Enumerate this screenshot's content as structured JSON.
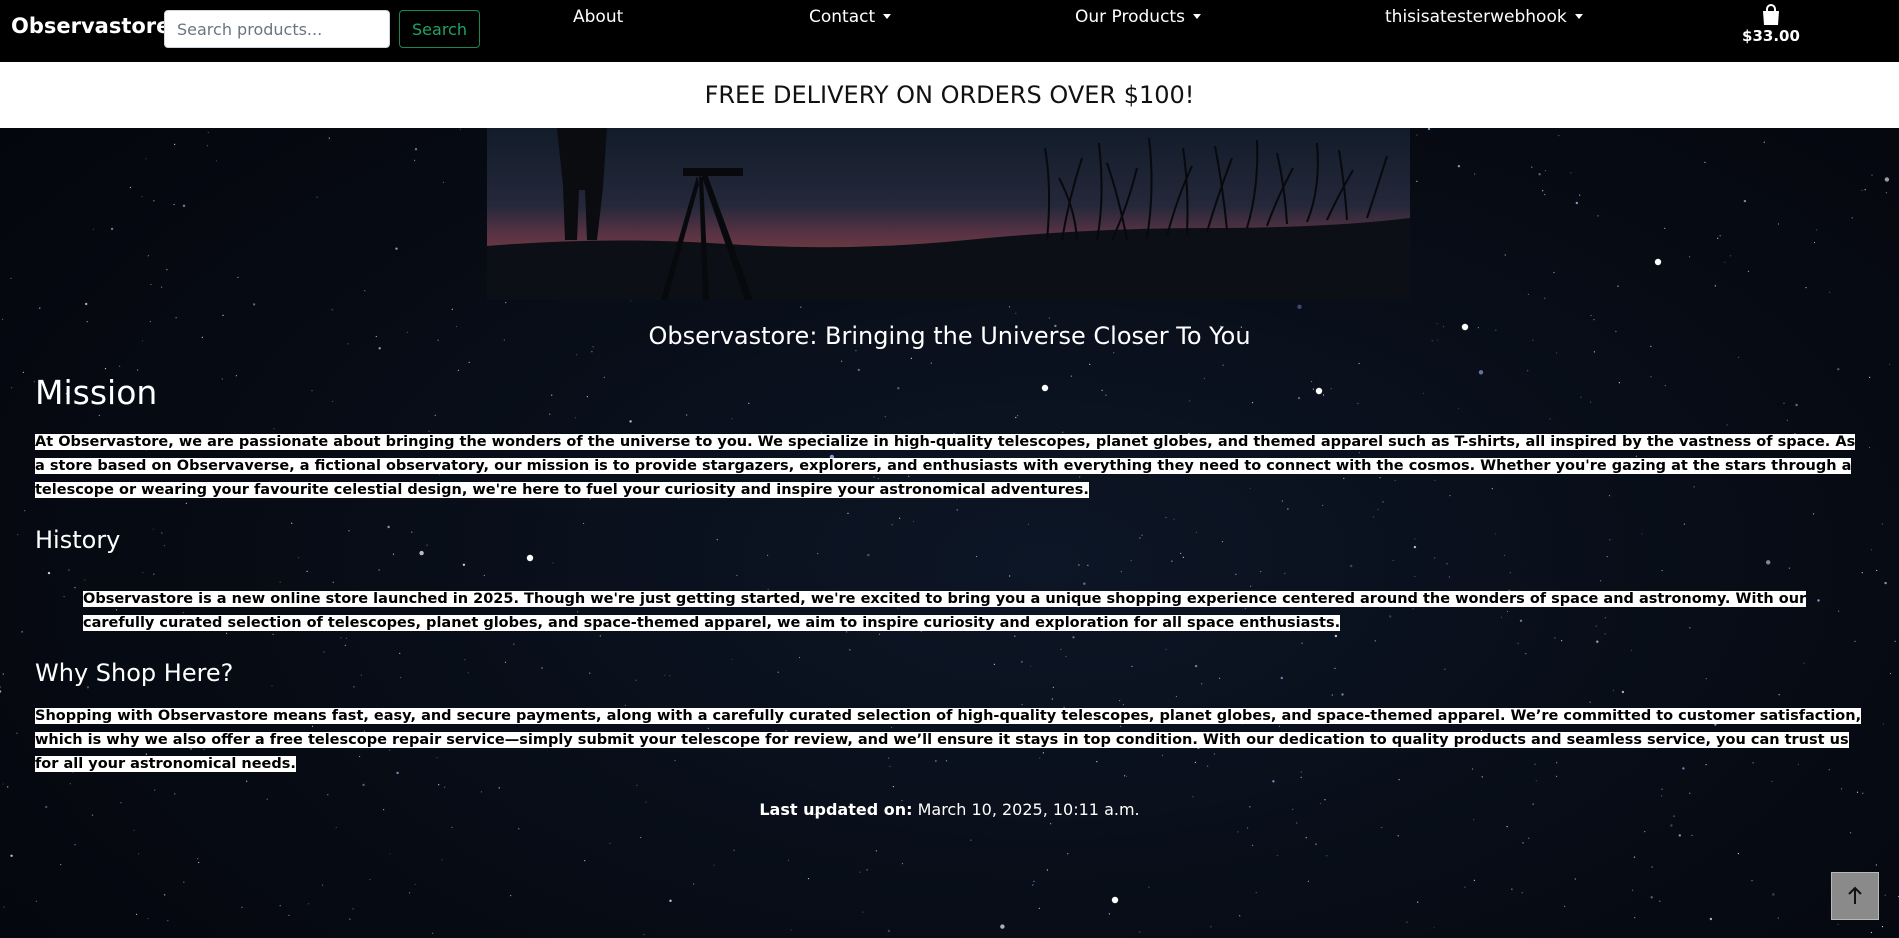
{
  "navbar": {
    "brand": "Observastore",
    "search_placeholder": "Search products...",
    "search_value": "",
    "search_button": "Search",
    "links": {
      "about": "About",
      "contact": "Contact",
      "products": "Our Products",
      "account": "thisisatesterwebhook"
    },
    "cart_total": "$33.00",
    "cart_icon": "shopping-bag-icon"
  },
  "banner": {
    "text": "FREE DELIVERY ON ORDERS OVER $100!"
  },
  "hero": {
    "image": "telescope-silhouette-at-dusk"
  },
  "main": {
    "tagline": "Observastore: Bringing the Universe Closer To You",
    "mission": {
      "heading": "Mission",
      "text": "At Observastore, we are passionate about bringing the wonders of the universe to you. We specialize in high-quality telescopes, planet globes, and themed apparel such as T-shirts, all inspired by the vastness of space. As a store based on Observaverse, a fictional observatory, our mission is to provide stargazers, explorers, and enthusiasts with everything they need to connect with the cosmos. Whether you're gazing at the stars through a telescope or wearing your favourite celestial design, we're here to fuel your curiosity and inspire your astronomical adventures."
    },
    "history": {
      "heading": "History",
      "text": "Observastore is a new online store launched in 2025. Though we're just getting started, we're excited to bring you a unique shopping experience centered around the wonders of space and astronomy. With our carefully curated selection of telescopes, planet globes, and space-themed apparel, we aim to inspire curiosity and exploration for all space enthusiasts."
    },
    "why": {
      "heading": "Why Shop Here?",
      "text": "Shopping with Observastore means fast, easy, and secure payments, along with a carefully curated selection of high-quality telescopes, planet globes, and space-themed apparel. We’re committed to customer satisfaction, which is why we also offer a free telescope repair service—simply submit your telescope for review, and we’ll ensure it stays in top condition. With our dedication to quality products and seamless service, you can trust us for all your astronomical needs."
    },
    "last_updated_label": "Last updated on:",
    "last_updated_value": "March 10, 2025, 10:11 a.m."
  },
  "scroll_top": {
    "icon": "arrow-up-icon"
  },
  "colors": {
    "navbar_bg": "#000000",
    "banner_bg": "#ffffff",
    "search_button_accent": "#198754",
    "text_highlight_bg": "#ffffff"
  }
}
